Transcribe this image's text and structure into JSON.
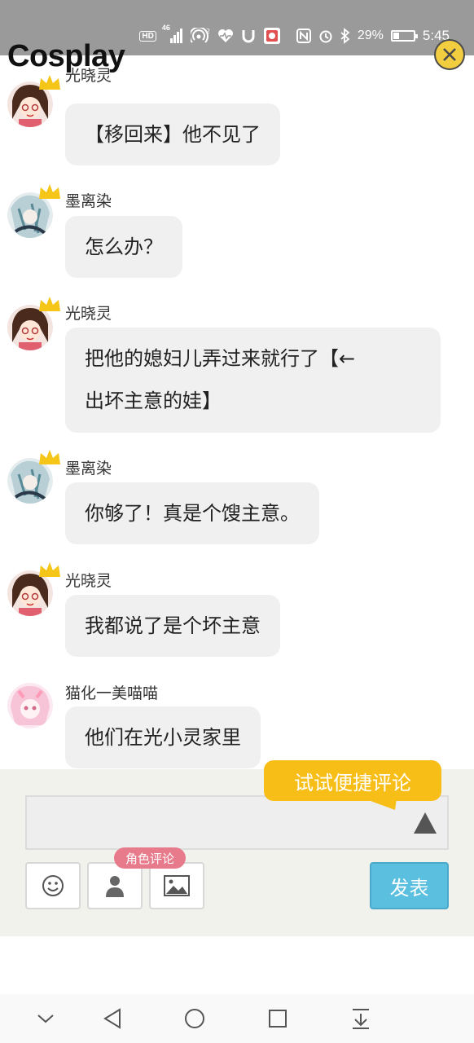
{
  "status_bar": {
    "hd_label": "HD",
    "signal_label": "46",
    "battery_percent": "29%",
    "battery_level": 0.29,
    "time": "5:45",
    "icons": [
      "hd-icon",
      "cell-signal-icon",
      "hotspot-icon",
      "health-icon",
      "shield-icon",
      "app-icon",
      "nfc-icon",
      "alarm-icon",
      "bluetooth-icon",
      "battery-icon"
    ]
  },
  "header": {
    "title": "Cosplay",
    "close_icon": "close-icon"
  },
  "messages": [
    {
      "user": "光晓灵",
      "text": "【移回来】他不见了",
      "avatar": "avatar-girl-pink",
      "crown": true
    },
    {
      "user": "墨离染",
      "text": "怎么办？",
      "avatar": "avatar-boy-teal",
      "crown": true
    },
    {
      "user": "光晓灵",
      "lines": [
        "把他的媳妇儿弄过来就行了【←",
        "出坏主意的娃】"
      ],
      "avatar": "avatar-girl-pink",
      "crown": true
    },
    {
      "user": "墨离染",
      "text": "你够了！真是个馊主意。",
      "avatar": "avatar-boy-teal",
      "crown": true
    },
    {
      "user": "光晓灵",
      "text": "我都说了是个坏主意",
      "avatar": "avatar-girl-pink",
      "crown": true
    },
    {
      "user": "猫化一美喵喵",
      "text": "他们在光小灵家里",
      "avatar": "avatar-pink-hair",
      "crown": false
    }
  ],
  "composer": {
    "tip": "试试便捷评论",
    "input_value": "",
    "expand_icon": "triangle-up-icon",
    "emoji_icon": "smiley-icon",
    "role_icon": "person-icon",
    "role_tag": "角色评论",
    "image_icon": "image-icon",
    "send_label": "发表"
  },
  "nav_bar": {
    "icons": [
      "chevron-down-icon",
      "back-triangle-icon",
      "home-circle-icon",
      "recents-square-icon",
      "pull-down-icon"
    ]
  },
  "colors": {
    "status_bar": "#9a9a9a",
    "bubble": "#f0f0f0",
    "tip": "#f7be18",
    "role_tag": "#e77a8b",
    "send": "#5bbfe0",
    "panel": "#f2f2ec",
    "close_button": "#f2cd40"
  }
}
